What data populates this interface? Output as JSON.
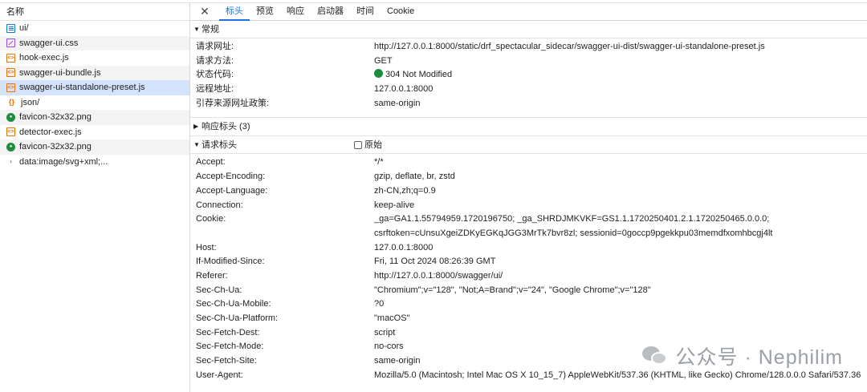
{
  "sidebar": {
    "header": "名称",
    "items": [
      {
        "name": "ui/",
        "icon": "document-icon"
      },
      {
        "name": "swagger-ui.css",
        "icon": "css-file-icon"
      },
      {
        "name": "hook-exec.js",
        "icon": "js-file-icon"
      },
      {
        "name": "swagger-ui-bundle.js",
        "icon": "js-file-icon"
      },
      {
        "name": "swagger-ui-standalone-preset.js",
        "icon": "js-file-icon"
      },
      {
        "name": "json/",
        "icon": "json-file-icon"
      },
      {
        "name": "favicon-32x32.png",
        "icon": "image-file-icon"
      },
      {
        "name": "detector-exec.js",
        "icon": "js-file-icon"
      },
      {
        "name": "favicon-32x32.png",
        "icon": "image-file-icon"
      },
      {
        "name": "data:image/svg+xml;...",
        "icon": "chevron-right-icon"
      }
    ]
  },
  "tabs": [
    "标头",
    "预览",
    "响应",
    "启动器",
    "时间",
    "Cookie"
  ],
  "general": {
    "title": "常规",
    "rows": [
      {
        "k": "请求网址:",
        "v": "http://127.0.0.1:8000/static/drf_spectacular_sidecar/swagger-ui-dist/swagger-ui-standalone-preset.js"
      },
      {
        "k": "请求方法:",
        "v": "GET"
      },
      {
        "k": "状态代码:",
        "v": "304 Not Modified"
      },
      {
        "k": "远程地址:",
        "v": "127.0.0.1:8000"
      },
      {
        "k": "引荐来源网址政策:",
        "v": "same-origin"
      }
    ]
  },
  "response_headers": {
    "title": "响应标头 (3)"
  },
  "request_headers": {
    "title": "请求标头",
    "raw_label": "原始",
    "rows": [
      {
        "k": "Accept:",
        "v": "*/*"
      },
      {
        "k": "Accept-Encoding:",
        "v": "gzip, deflate, br, zstd"
      },
      {
        "k": "Accept-Language:",
        "v": "zh-CN,zh;q=0.9"
      },
      {
        "k": "Connection:",
        "v": "keep-alive"
      },
      {
        "k": "Cookie:",
        "v": "_ga=GA1.1.55794959.1720196750; _ga_SHRDJMKVKF=GS1.1.1720250401.2.1.1720250465.0.0.0; csrftoken=cUnsuXgeiZDKyEGKqJGG3MrTk7bvr8zl; sessionid=0goccp9pgekkpu03memdfxomhbcgj4lt"
      },
      {
        "k": "Host:",
        "v": "127.0.0.1:8000"
      },
      {
        "k": "If-Modified-Since:",
        "v": "Fri, 11 Oct 2024 08:26:39 GMT"
      },
      {
        "k": "Referer:",
        "v": "http://127.0.0.1:8000/swagger/ui/"
      },
      {
        "k": "Sec-Ch-Ua:",
        "v": "\"Chromium\";v=\"128\", \"Not;A=Brand\";v=\"24\", \"Google Chrome\";v=\"128\""
      },
      {
        "k": "Sec-Ch-Ua-Mobile:",
        "v": "?0"
      },
      {
        "k": "Sec-Ch-Ua-Platform:",
        "v": "\"macOS\""
      },
      {
        "k": "Sec-Fetch-Dest:",
        "v": "script"
      },
      {
        "k": "Sec-Fetch-Mode:",
        "v": "no-cors"
      },
      {
        "k": "Sec-Fetch-Site:",
        "v": "same-origin"
      },
      {
        "k": "User-Agent:",
        "v": "Mozilla/5.0 (Macintosh; Intel Mac OS X 10_15_7) AppleWebKit/537.36 (KHTML, like Gecko) Chrome/128.0.0.0 Safari/537.36"
      }
    ]
  },
  "watermark": "公众号 · Nephilim",
  "colors": {
    "accent": "#1a73e8",
    "selected_bg": "#d3e3fd",
    "status_ok": "#1e8e3e"
  }
}
